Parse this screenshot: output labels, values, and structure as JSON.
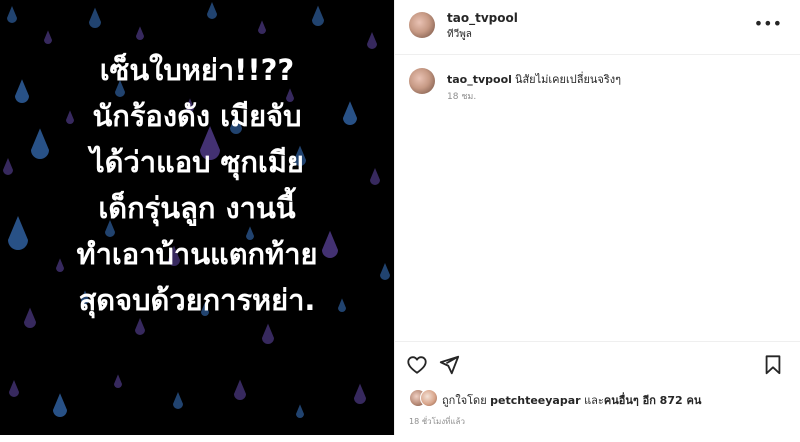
{
  "media": {
    "lines": [
      "เซ็นใบหย่า!!??",
      "นักร้องดัง เมียจับ",
      "ได้ว่าแอบ ซุกเมีย",
      "เด็กรุ่นลูก งานนี้",
      "ทำเอาบ้านแตกท้าย",
      "สุดจบด้วยการหย่า."
    ],
    "rain_colors": [
      "#2f5f9e",
      "#4f3a86"
    ]
  },
  "header": {
    "username": "tao_tvpool",
    "subtitle": "ทีวีพูล",
    "more_icon": "more-icon"
  },
  "caption": {
    "username": "tao_tvpool",
    "text": "นิสัยไม่เคยเปลี่ยนจริงๆ",
    "time": "18 ชม."
  },
  "actions": {
    "icons": [
      "heart-icon",
      "share-icon",
      "bookmark-icon"
    ]
  },
  "likes": {
    "prefix": "ถูกใจโดย",
    "user": "petchteeyapar",
    "middle": "และ",
    "others": "คนอื่นๆ อีก 872 คน"
  },
  "timeago": "18 ชั่วโมงที่แล้ว"
}
